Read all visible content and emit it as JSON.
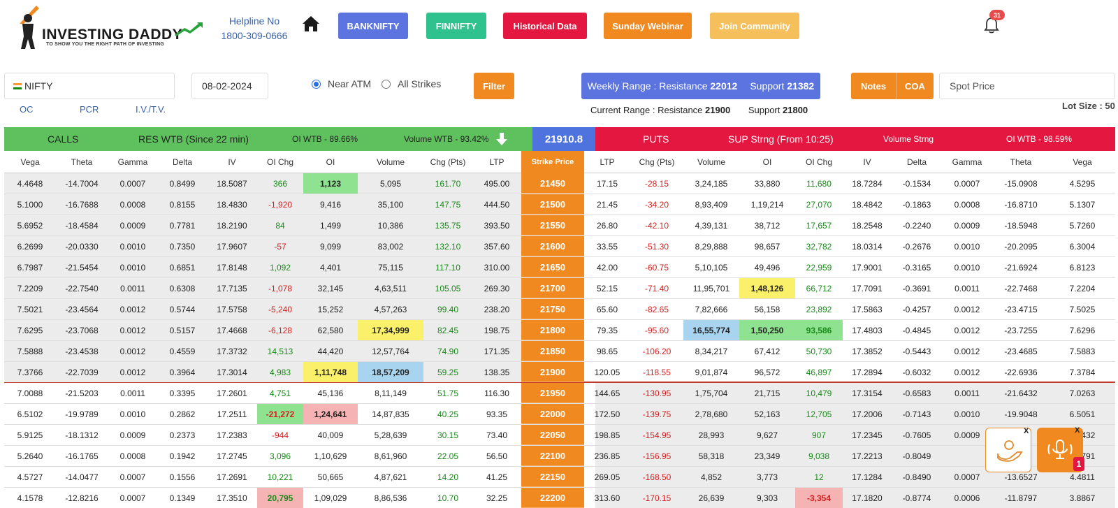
{
  "header": {
    "logo_text": "INVESTING DADDY",
    "logo_tagline": "TO SHOW YOU THE RIGHT PATH OF INVESTING",
    "helpline_label": "Helpline No",
    "helpline_number": "1800-309-0666",
    "nav": [
      {
        "label": "BANKNIFTY",
        "color": "#5b74e0"
      },
      {
        "label": "FINNIFTY",
        "color": "#2fc28f"
      },
      {
        "label": "Historical Data",
        "color": "#e3173f"
      },
      {
        "label": "Sunday Webinar",
        "color": "#f0891f"
      },
      {
        "label": "Join Community",
        "color": "#f5c05b"
      }
    ],
    "notification_count": "31"
  },
  "controls": {
    "symbol": "NIFTY",
    "date": "08-02-2024",
    "radio_near_atm": "Near ATM",
    "radio_all_strikes": "All Strikes",
    "filter_label": "Filter",
    "weekly_range_label": "Weekly Range : Resistance",
    "weekly_resistance": "22012",
    "weekly_support_label": "Support",
    "weekly_support": "21382",
    "current_range_label": "Current Range : Resistance",
    "current_resistance": "21900",
    "current_support_label": "Support",
    "current_support": "21800",
    "notes_label": "Notes",
    "coa_label": "COA",
    "spot_placeholder": "Spot Price",
    "lot_size": "Lot Size : 50",
    "tabs": [
      "OC",
      "PCR",
      "I.V./T.V."
    ]
  },
  "chain_header": {
    "calls": "CALLS",
    "calls_res": "RES WTB (Since 22 min)",
    "calls_oi": "OI WTB - 89.66%",
    "calls_volume": "Volume WTB - 93.42%",
    "spot": "21910.8",
    "puts": "PUTS",
    "puts_sup": "SUP Strng (From 10:25)",
    "puts_volume": "Volume Strng",
    "puts_oi": "OI WTB - 98.59%"
  },
  "columns": [
    "Vega",
    "Theta",
    "Gamma",
    "Delta",
    "IV",
    "OI Chg",
    "OI",
    "Volume",
    "Chg (Pts)",
    "LTP",
    "Strike Price",
    "LTP",
    "Chg (Pts)",
    "Volume",
    "OI",
    "OI Chg",
    "IV",
    "Delta",
    "Gamma",
    "Theta",
    "Vega"
  ],
  "rows": [
    {
      "strike": "21450",
      "c": [
        "4.4648",
        "-14.7004",
        "0.0007",
        "0.8499",
        "18.5087",
        "366",
        "1,123",
        "5,095",
        "161.70",
        "495.00"
      ],
      "p": [
        "17.15",
        "-28.15",
        "3,24,185",
        "33,880",
        "11,680",
        "18.7284",
        "-0.1534",
        "0.0007",
        "-15.0908",
        "4.5295"
      ]
    },
    {
      "strike": "21500",
      "c": [
        "5.1000",
        "-16.7688",
        "0.0008",
        "0.8155",
        "18.4830",
        "-1,920",
        "9,416",
        "35,100",
        "147.75",
        "444.50"
      ],
      "p": [
        "21.45",
        "-34.20",
        "8,93,409",
        "1,19,214",
        "27,070",
        "18.4842",
        "-0.1863",
        "0.0008",
        "-16.8710",
        "5.1307"
      ]
    },
    {
      "strike": "21550",
      "c": [
        "5.6952",
        "-18.4584",
        "0.0009",
        "0.7781",
        "18.2190",
        "84",
        "1,499",
        "10,386",
        "135.75",
        "393.50"
      ],
      "p": [
        "26.80",
        "-42.10",
        "4,39,131",
        "38,712",
        "17,657",
        "18.2548",
        "-0.2240",
        "0.0009",
        "-18.5948",
        "5.7260"
      ]
    },
    {
      "strike": "21600",
      "c": [
        "6.2699",
        "-20.0330",
        "0.0010",
        "0.7350",
        "17.9607",
        "-57",
        "9,099",
        "83,002",
        "132.10",
        "357.60"
      ],
      "p": [
        "33.55",
        "-51.30",
        "8,29,888",
        "98,657",
        "32,782",
        "18.0314",
        "-0.2676",
        "0.0010",
        "-20.2095",
        "6.3004"
      ]
    },
    {
      "strike": "21650",
      "c": [
        "6.7987",
        "-21.5454",
        "0.0010",
        "0.6851",
        "17.8148",
        "1,092",
        "4,401",
        "75,115",
        "117.10",
        "310.00"
      ],
      "p": [
        "42.00",
        "-60.75",
        "5,10,105",
        "49,496",
        "22,959",
        "17.9001",
        "-0.3165",
        "0.0010",
        "-21.6924",
        "6.8123"
      ]
    },
    {
      "strike": "21700",
      "c": [
        "7.2209",
        "-22.7540",
        "0.0011",
        "0.6308",
        "17.7135",
        "-1,078",
        "32,145",
        "4,63,511",
        "105.05",
        "269.30"
      ],
      "p": [
        "52.15",
        "-71.40",
        "11,95,701",
        "1,48,126",
        "66,712",
        "17.7091",
        "-0.3691",
        "0.0011",
        "-22.7468",
        "7.2204"
      ]
    },
    {
      "strike": "21750",
      "c": [
        "7.5021",
        "-23.4564",
        "0.0012",
        "0.5744",
        "17.5758",
        "-5,240",
        "15,252",
        "4,57,263",
        "99.40",
        "238.20"
      ],
      "p": [
        "65.60",
        "-82.65",
        "7,82,666",
        "56,158",
        "23,892",
        "17.5863",
        "-0.4257",
        "0.0012",
        "-23.4715",
        "7.5025"
      ]
    },
    {
      "strike": "21800",
      "c": [
        "7.6295",
        "-23.7068",
        "0.0012",
        "0.5157",
        "17.4668",
        "-6,128",
        "62,580",
        "17,34,999",
        "82.45",
        "198.75"
      ],
      "p": [
        "79.35",
        "-95.60",
        "16,55,774",
        "1,50,250",
        "93,586",
        "17.4803",
        "-0.4845",
        "0.0012",
        "-23.7255",
        "7.6296"
      ]
    },
    {
      "strike": "21850",
      "c": [
        "7.5888",
        "-23.4538",
        "0.0012",
        "0.4559",
        "17.3732",
        "14,513",
        "44,420",
        "12,57,764",
        "74.90",
        "171.35"
      ],
      "p": [
        "98.65",
        "-106.20",
        "8,34,217",
        "67,412",
        "50,730",
        "17.3852",
        "-0.5443",
        "0.0012",
        "-23.4685",
        "7.5883"
      ]
    },
    {
      "strike": "21900",
      "c": [
        "7.3766",
        "-22.7039",
        "0.0012",
        "0.3964",
        "17.3014",
        "4,983",
        "1,11,748",
        "18,57,209",
        "59.25",
        "138.35"
      ],
      "p": [
        "120.05",
        "-118.55",
        "9,01,874",
        "96,572",
        "46,897",
        "17.2894",
        "-0.6032",
        "0.0012",
        "-22.6936",
        "7.3784"
      ]
    },
    {
      "strike": "21950",
      "c": [
        "7.0088",
        "-21.5203",
        "0.0011",
        "0.3395",
        "17.2601",
        "4,751",
        "45,136",
        "8,11,149",
        "51.75",
        "116.30"
      ],
      "p": [
        "144.65",
        "-130.95",
        "1,75,704",
        "21,715",
        "10,479",
        "17.3154",
        "-0.6583",
        "0.0011",
        "-21.6432",
        "7.0263"
      ]
    },
    {
      "strike": "22000",
      "c": [
        "6.5102",
        "-19.9789",
        "0.0010",
        "0.2862",
        "17.2511",
        "-21,272",
        "1,24,641",
        "14,87,835",
        "40.25",
        "93.35"
      ],
      "p": [
        "172.50",
        "-139.75",
        "2,78,680",
        "52,163",
        "12,705",
        "17.2006",
        "-0.7143",
        "0.0010",
        "-19.9048",
        "6.5051"
      ]
    },
    {
      "strike": "22050",
      "c": [
        "5.9125",
        "-18.1312",
        "0.0009",
        "0.2373",
        "17.2383",
        "-944",
        "40,009",
        "5,28,639",
        "30.15",
        "73.40"
      ],
      "p": [
        "198.85",
        "-154.95",
        "28,993",
        "9,627",
        "907",
        "17.2345",
        "-0.7605",
        "0.0009",
        "",
        "5.9432"
      ]
    },
    {
      "strike": "22100",
      "c": [
        "5.2640",
        "-16.1765",
        "0.0008",
        "0.1942",
        "17.2745",
        "3,096",
        "1,10,629",
        "8,61,960",
        "22.05",
        "56.50"
      ],
      "p": [
        "236.85",
        "-156.95",
        "58,318",
        "23,349",
        "9,038",
        "17.2213",
        "-0.8049",
        "",
        "",
        "5.2791"
      ]
    },
    {
      "strike": "22150",
      "c": [
        "4.5727",
        "-14.0477",
        "0.0007",
        "0.1556",
        "17.2691",
        "10,221",
        "50,665",
        "4,87,621",
        "14.20",
        "41.25"
      ],
      "p": [
        "269.05",
        "-168.50",
        "4,852",
        "3,773",
        "12",
        "17.1284",
        "-0.8490",
        "0.0007",
        "-13.6527",
        "4.4811"
      ]
    },
    {
      "strike": "22200",
      "c": [
        "4.1578",
        "-12.8216",
        "0.0007",
        "0.1349",
        "17.3510",
        "20,795",
        "1,09,029",
        "8,86,536",
        "10.70",
        "32.25"
      ],
      "p": [
        "313.60",
        "-170.15",
        "26,639",
        "9,303",
        "-3,354",
        "17.1820",
        "-0.8774",
        "0.0006",
        "-11.8797",
        "3.8867"
      ]
    }
  ],
  "highlights": {
    "green": "#8fe28f",
    "yellow": "#fbf06a",
    "blue": "#a9d4ef",
    "red": "#f6b3b3"
  },
  "float_badge": "1",
  "float_close": "X"
}
